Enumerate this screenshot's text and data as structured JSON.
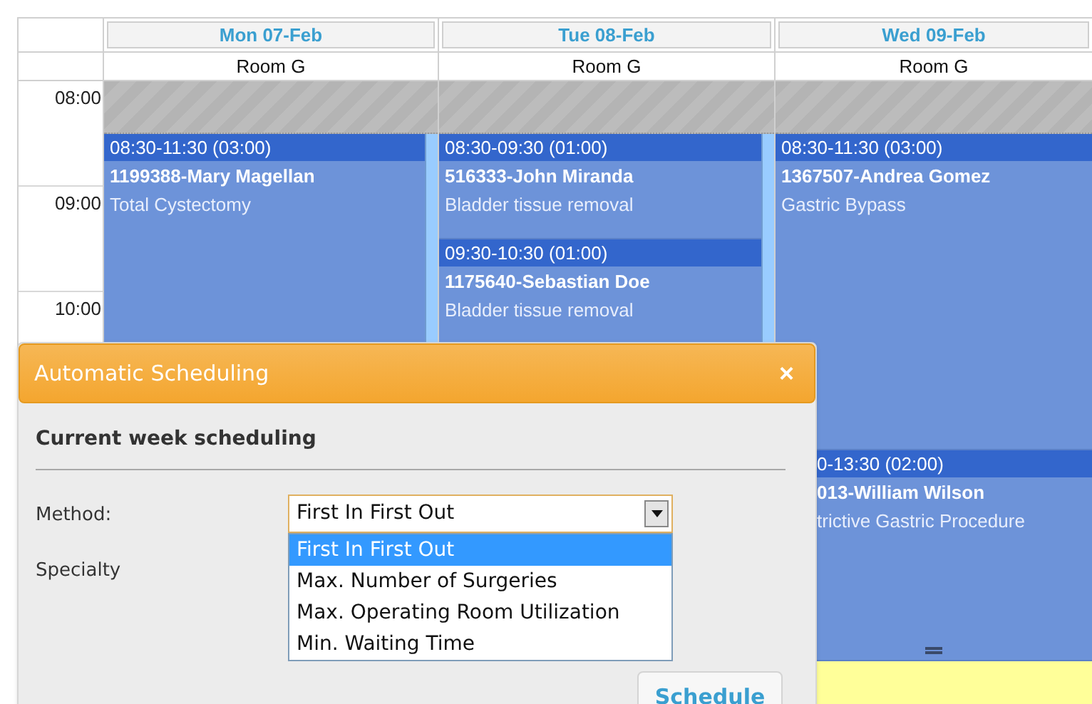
{
  "calendar": {
    "times": [
      "08:00",
      "09:00",
      "10:00"
    ],
    "days": [
      {
        "label": "Mon 07-Feb",
        "room": "Room G",
        "events": [
          {
            "kind": "full",
            "time": "08:30-11:30 (03:00)",
            "patient": "1199388-Mary Magellan",
            "procedure": "Total Cystectomy"
          }
        ]
      },
      {
        "label": "Tue 08-Feb",
        "room": "Room G",
        "events": [
          {
            "kind": "full",
            "time": "08:30-09:30 (01:00)",
            "patient": "516333-John Miranda",
            "procedure": "Bladder tissue removal"
          },
          {
            "kind": "full",
            "time": "09:30-10:30 (01:00)",
            "patient": "1175640-Sebastian Doe",
            "procedure": "Bladder tissue removal"
          }
        ]
      },
      {
        "label": "Wed 09-Feb",
        "room": "Room G",
        "events": [
          {
            "kind": "full",
            "time": "08:30-11:30 (03:00)",
            "patient": "1367507-Andrea Gomez",
            "procedure": "Gastric Bypass"
          },
          {
            "kind": "covered",
            "time": "0-13:30 (02:00)",
            "patient": "013-William Wilson",
            "procedure": "trictive Gastric Procedure"
          }
        ]
      }
    ]
  },
  "dialog": {
    "title": "Automatic Scheduling",
    "close": "×",
    "heading": "Current week scheduling",
    "method": {
      "label": "Method:",
      "value": "First In First Out",
      "expanded": true,
      "options": [
        {
          "label": "First In First Out",
          "selected": true
        },
        {
          "label": "Max. Number of Surgeries",
          "selected": false
        },
        {
          "label": "Max. Operating Room Utilization",
          "selected": false
        },
        {
          "label": "Min. Waiting Time",
          "selected": false
        }
      ]
    },
    "specialty": {
      "label": "Specialty"
    },
    "button": "Schedule"
  }
}
